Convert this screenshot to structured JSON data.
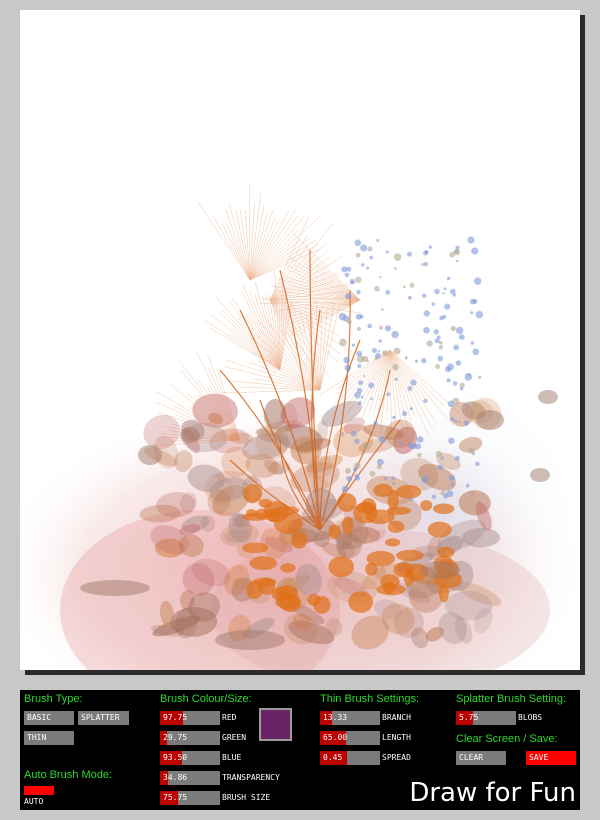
{
  "canvas": {
    "name": "drawing-canvas"
  },
  "brush_type": {
    "header": "Brush Type:",
    "options": [
      "BASIC",
      "SPLATTER",
      "THIN"
    ]
  },
  "auto_brush": {
    "header": "Auto Brush Mode:",
    "label": "AUTO",
    "color": "#ff0000"
  },
  "colour": {
    "header": "Brush Colour/Size:",
    "swatch_color": "#6b2368",
    "sliders": [
      {
        "value": "97.75",
        "label": "RED",
        "fraction": 0.38
      },
      {
        "value": "29.75",
        "label": "GREEN",
        "fraction": 0.12
      },
      {
        "value": "93.50",
        "label": "BLUE",
        "fraction": 0.37
      },
      {
        "value": "34.86",
        "label": "TRANSPARENCY",
        "fraction": 0.14
      },
      {
        "value": "75.75",
        "label": "BRUSH SIZE",
        "fraction": 0.3
      }
    ]
  },
  "thin": {
    "header": "Thin Brush Settings:",
    "sliders": [
      {
        "value": "13.33",
        "label": "BRANCH",
        "fraction": 0.2
      },
      {
        "value": "65.00",
        "label": "LENGTH",
        "fraction": 0.43
      },
      {
        "value": "0.45",
        "label": "SPREAD",
        "fraction": 0.45
      }
    ]
  },
  "splatter": {
    "header": "Splatter Brush Setting:",
    "sliders": [
      {
        "value": "5.75",
        "label": "BLOBS",
        "fraction": 0.28
      }
    ]
  },
  "clear_save": {
    "header": "Clear Screen / Save:",
    "clear_label": "CLEAR",
    "save_label": "SAVE"
  },
  "brand": "Draw for Fun",
  "colors": {
    "panel_bg": "#000000",
    "header_green": "#2bd82b",
    "slider_fill": "#bb0000",
    "button_grey": "#7b7b7b"
  }
}
